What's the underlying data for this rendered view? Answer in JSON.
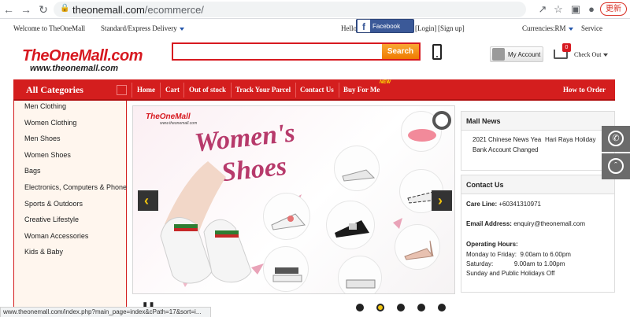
{
  "browser": {
    "url_host": "theonemall.com",
    "url_path": "/ecommerce/",
    "update_label": "更新"
  },
  "topbar": {
    "welcome": "Welcome to TheOneMall",
    "delivery": "Standard/Express Delivery",
    "hello": "Hello",
    "facebook_login": "Facebook Login",
    "login": "[Login]",
    "signup": "[Sign up]",
    "currencies": "Currencies:RM",
    "service": "Service"
  },
  "header": {
    "logo": "TheOneMall.com",
    "logo_sub": "www.theonemall.com",
    "search_label": "Search",
    "search_placeholder": "",
    "my_account": "My Account",
    "cart_count": "0",
    "checkout": "Check Out"
  },
  "nav": {
    "all_categories": "All Categories",
    "items": [
      "Home",
      "Cart",
      "Out of stock",
      "Track Your Parcel",
      "Contact Us",
      "Buy For Me",
      "How to Order"
    ],
    "new_badge": "NEW"
  },
  "categories": [
    "Men Clothing",
    "Women Clothing",
    "Men Shoes",
    "Women Shoes",
    "Bags",
    "Electronics, Computers & Phone",
    "Sports & Outdoors",
    "Creative Lifestyle",
    "Woman Accessories",
    "Kids & Baby"
  ],
  "banner": {
    "logo": "TheOneMall",
    "logo_sub": "www.theonemall.com",
    "title_line1": "Women's",
    "title_line2": "Shoes",
    "slide_count": 5,
    "active_slide": 2
  },
  "news": {
    "title": "Mall News",
    "item1": "2021 Chinese News Yea",
    "item2": "Hari Raya Holiday",
    "item3": "Bank Account Changed"
  },
  "contact": {
    "title": "Contact Us",
    "care_label": "Care Line:",
    "care_value": "+60341310971",
    "email_label": "Email Address:",
    "email_value": "enquiry@theonemall.com",
    "hours_label": "Operating Hours:",
    "hours_weekday": "Monday to Friday:  9.00am to 6.00pm",
    "hours_saturday": "Saturday:            9.00am to 1.00pm",
    "hours_holiday": "Sunday and Public Holidays Off"
  },
  "status_bar": "www.theonemall.com/index.php?main_page=index&cPath=17&sort=i...",
  "colors": {
    "brand_red": "#d41e1e",
    "search_orange": "#ef7a00",
    "facebook_blue": "#3b5998",
    "slide_active": "#f1c40f"
  }
}
